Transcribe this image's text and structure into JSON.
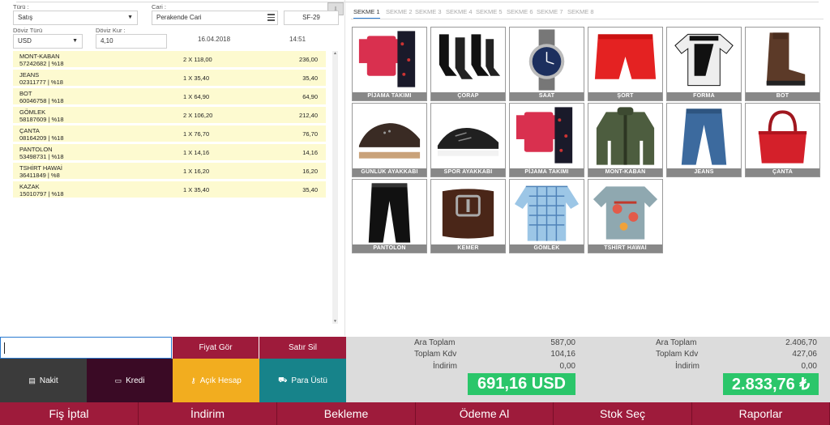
{
  "form": {
    "turu_label": "Türü :",
    "turu_value": "Satış",
    "cari_label": "Cari :",
    "cari_value": "Perakende Cari",
    "doc_no": "SF-29",
    "doviz_turu_label": "Döviz Türü",
    "doviz_turu_value": "USD",
    "doviz_kur_label": "Döviz Kur :",
    "doviz_kur_value": "4,10",
    "date": "16.04.2018",
    "time": "14:51"
  },
  "receipt_items": [
    {
      "name": "MONT-KABAN",
      "code": "57242682 | %18",
      "qty": "2 X 118,00",
      "total": "236,00"
    },
    {
      "name": "JEANS",
      "code": "02311777 | %18",
      "qty": "1 X 35,40",
      "total": "35,40"
    },
    {
      "name": "BOT",
      "code": "60046758 | %18",
      "qty": "1 X 64,90",
      "total": "64,90"
    },
    {
      "name": "GÖMLEK",
      "code": "58187609 | %18",
      "qty": "2 X 106,20",
      "total": "212,40"
    },
    {
      "name": "ÇANTA",
      "code": "08164209 | %18",
      "qty": "1 X 76,70",
      "total": "76,70"
    },
    {
      "name": "PANTOLON",
      "code": "53498731 | %18",
      "qty": "1 X 14,16",
      "total": "14,16"
    },
    {
      "name": "TSHİRT HAWAİ",
      "code": "36411849 | %8",
      "qty": "1 X 16,20",
      "total": "16,20"
    },
    {
      "name": "KAZAK",
      "code": "15010797 | %18",
      "qty": "1 X 35,40",
      "total": "35,40"
    }
  ],
  "tabs": [
    "SEKME 1",
    "SEKME 2",
    "SEKME 3",
    "SEKME 4",
    "SEKME 5",
    "SEKME 6",
    "SEKME 7",
    "SEKME 8"
  ],
  "products": [
    "PİJAMA TAKIMI",
    "ÇORAP",
    "SAAT",
    "ŞORT",
    "FORMA",
    "BOT",
    "GÜNLÜK AYAKKABI",
    "SPOR AYAKKABI",
    "PİJAMA TAKIMI",
    "MONT-KABAN",
    "JEANS",
    "ÇANTA",
    "PANTOLON",
    "KEMER",
    "GÖMLEK",
    "TSHİRT HAWAİ"
  ],
  "buttons": {
    "fiyat_gor": "Fiyat Gör",
    "satir_sil": "Satır Sil",
    "nakit": "Nakit",
    "kredi": "Kredi",
    "acik_hesap": "Açık Hesap",
    "para_ustu": "Para Üstü"
  },
  "totals_usd": {
    "ara_toplam_label": "Ara Toplam",
    "ara_toplam": "587,00",
    "kdv_label": "Toplam Kdv",
    "kdv": "104,16",
    "indirim_label": "İndirim",
    "indirim": "0,00",
    "grand": "691,16 USD"
  },
  "totals_try": {
    "ara_toplam_label": "Ara Toplam",
    "ara_toplam": "2.406,70",
    "kdv_label": "Toplam Kdv",
    "kdv": "427,06",
    "indirim_label": "İndirim",
    "indirim": "0,00",
    "grand": "2.833,76 ₺"
  },
  "footer": [
    "Fiş İptal",
    "İndirim",
    "Bekleme",
    "Ödeme Al",
    "Stok Seç",
    "Raporlar"
  ],
  "colors": {
    "dark_red": "#9e1b3b",
    "nakit": "#3b3b3b",
    "kredi": "#3a0a25",
    "acik_hesap": "#f2ad1f",
    "para_ustu": "#17838a",
    "green": "#2bc66a",
    "row_bg": "#fdfad0"
  }
}
